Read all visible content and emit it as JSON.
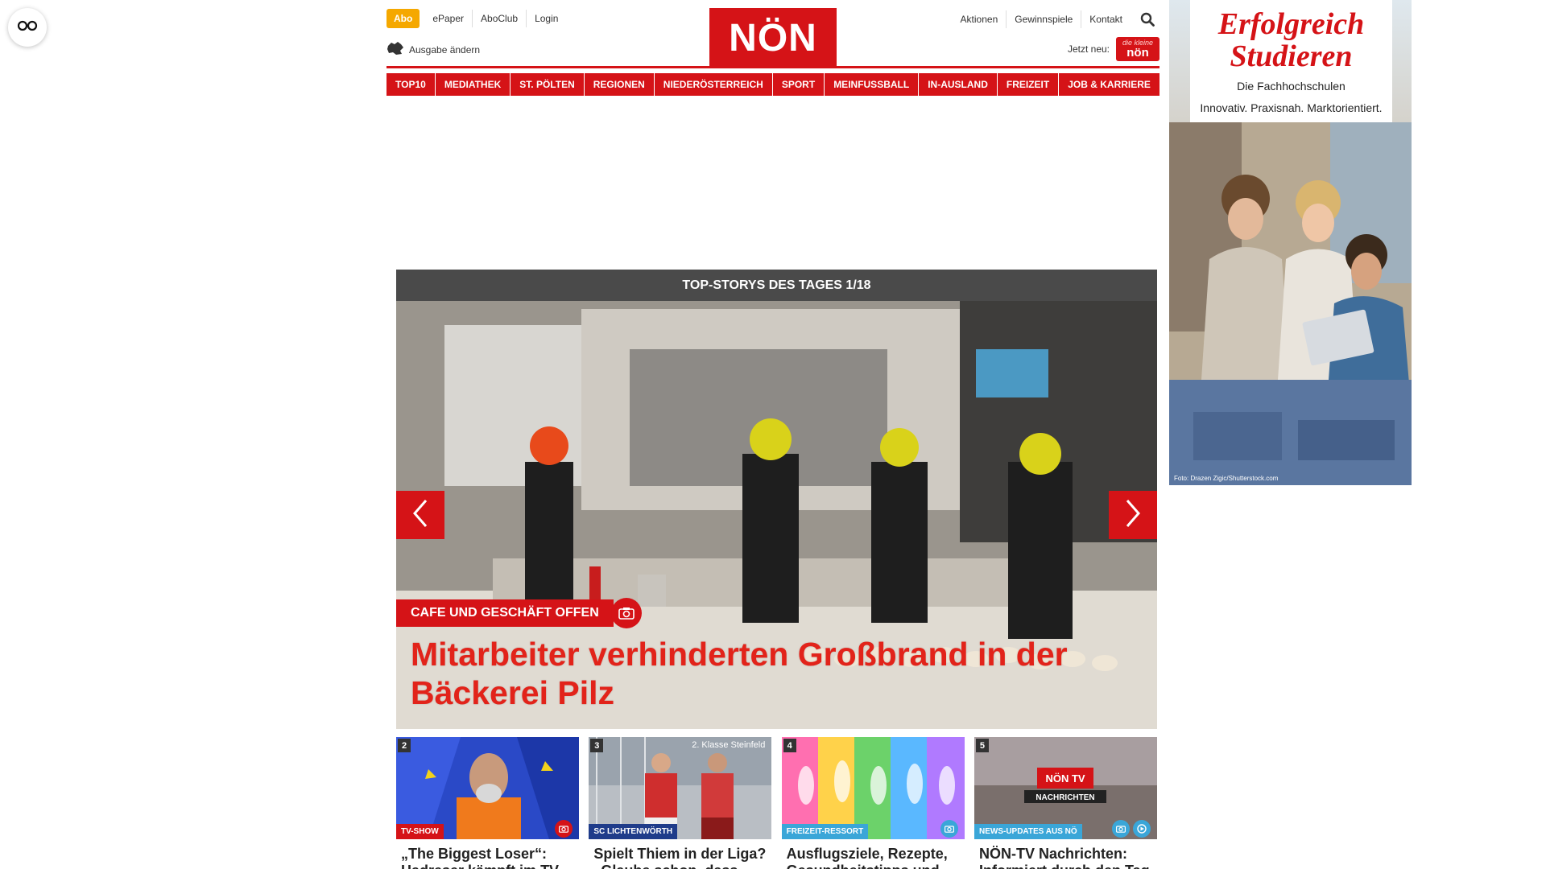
{
  "colors": {
    "brand_red": "#d51317",
    "abo_yellow": "#f5a800",
    "header_gray": "#4a4a4a",
    "headline_red": "#e2231a"
  },
  "accessibility": {
    "icon": "glasses-icon"
  },
  "header": {
    "abo": "Abo",
    "links_left": [
      "ePaper",
      "AboClub",
      "Login"
    ],
    "ausgabe": "Ausgabe ändern",
    "logo": "NÖN",
    "links_right": [
      "Aktionen",
      "Gewinnspiele",
      "Kontakt"
    ],
    "jetzt_neu": "Jetzt neu:",
    "jetzt_badge_small": "die kleine",
    "jetzt_badge_big": "nön"
  },
  "nav": [
    "TOP10",
    "MEDIATHEK",
    "ST. PÖLTEN",
    "REGIONEN",
    "NIEDERÖSTERREICH",
    "SPORT",
    "MEINFUSSBALL",
    "IN-AUSLAND",
    "FREIZEIT",
    "JOB & KARRIERE"
  ],
  "ad": {
    "title_line1": "Erfolgreich",
    "title_line2": "Studieren",
    "sub_line1": "Die Fachhochschulen",
    "sub_line2": "Innovativ. Praxisnah. Marktorientiert.",
    "credit": "Foto: Drazen Zigic/Shutterstock.com"
  },
  "carousel": {
    "header": "TOP-STORYS DES TAGES 1/18",
    "category": "CAFE UND GESCHÄFT OFFEN",
    "headline": "Mitarbeiter verhinderten Großbrand in der Bäckerei Pilz"
  },
  "teasers": [
    {
      "num": "2",
      "category": "TV-SHOW",
      "cat_color": "#d51317",
      "title": "„The Biggest Loser“: Hadreser kämpft im TV"
    },
    {
      "num": "3",
      "category": "SC LICHTENWÖRTH",
      "cat_color": "#1f3c8a",
      "overlay": "2. Klasse Steinfeld",
      "title": "Spielt Thiem in der Liga? „Glaube schon, dass das"
    },
    {
      "num": "4",
      "category": "FREIZEIT-RESSORT",
      "cat_color": "#3aa6d8",
      "title": "Ausflugsziele, Rezepte, Gesundheitstipps und"
    },
    {
      "num": "5",
      "category": "NEWS-UPDATES AUS NÖ",
      "cat_color": "#3aa6d8",
      "title": "NÖN-TV Nachrichten: Informiert durch den Tag"
    }
  ]
}
